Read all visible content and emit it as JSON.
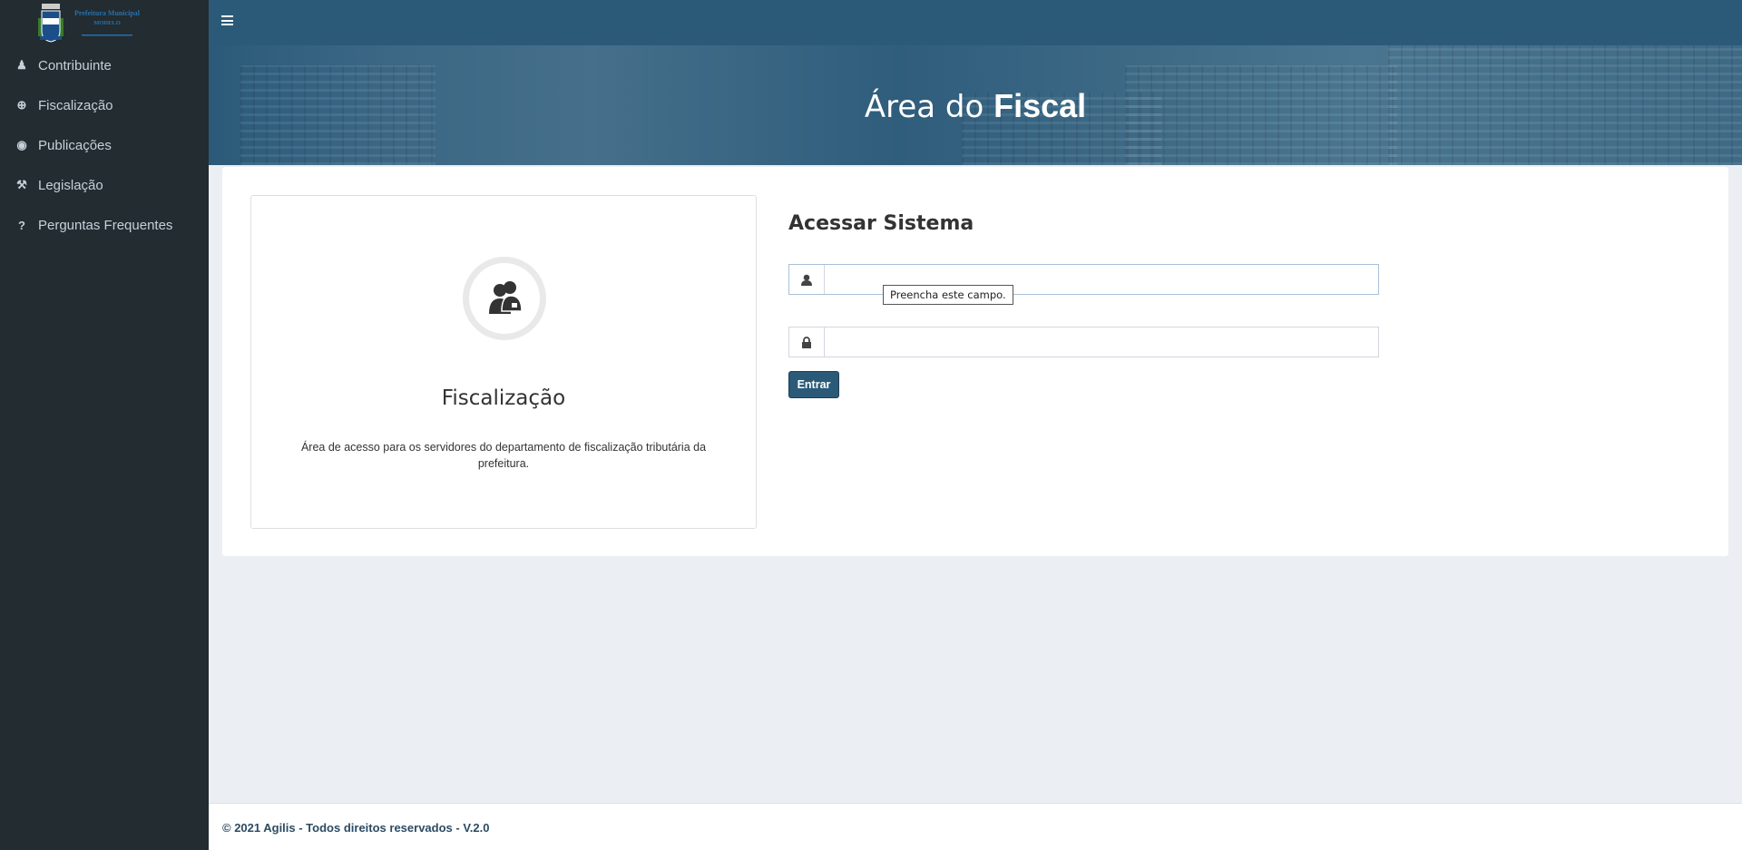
{
  "logo": {
    "line1": "Prefeitura Municipal",
    "line2": "MODELO"
  },
  "sidebar": {
    "items": [
      {
        "label": "Contribuinte",
        "icon": "user-icon"
      },
      {
        "label": "Fiscalização",
        "icon": "zoom-in-icon"
      },
      {
        "label": "Publicações",
        "icon": "globe-icon"
      },
      {
        "label": "Legislação",
        "icon": "gavel-icon"
      },
      {
        "label": "Perguntas Frequentes",
        "icon": "question-icon"
      }
    ]
  },
  "banner": {
    "title_light": "Área do",
    "title_bold": "Fiscal"
  },
  "card": {
    "title": "Fiscalização",
    "description": "Área de acesso para os servidores do departamento de fiscalização tributária da prefeitura."
  },
  "login": {
    "title": "Acessar Sistema",
    "username": "",
    "password": "",
    "submit_label": "Entrar",
    "tooltip": "Preencha este campo."
  },
  "footer": {
    "text": "© 2021 Agilis - Todos direitos reservados - V.2.0"
  },
  "colors": {
    "primary": "#2b5a79",
    "sidebar": "#222c31",
    "background": "#ebeef2"
  }
}
